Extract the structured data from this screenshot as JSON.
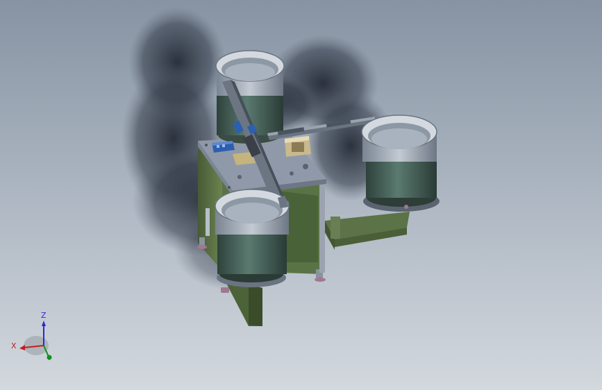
{
  "viewport": {
    "background_top": "#8793a3",
    "background_bottom": "#d3d8de"
  },
  "model": {
    "frame_color": "#556b40",
    "plate_color": "#8e98a8",
    "bowl_outer_color": "#3f5650",
    "bowl_rim_color": "#d0d6dc",
    "rail_color": "#6a7480",
    "accent_blue": "#2d5fb0",
    "accent_tan": "#c9b98c"
  },
  "triad": {
    "z_label": "Z",
    "x_label": "X",
    "y_label": "Y",
    "z_color": "#2a2ad0",
    "x_color": "#c02020",
    "y_color": "#109020"
  }
}
